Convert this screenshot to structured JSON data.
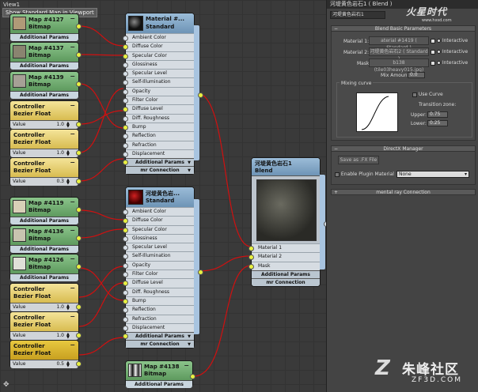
{
  "viewport": {
    "title": "View1",
    "tooltip": "Show Standard Map in Viewport",
    "map_nodes": [
      {
        "name": "Map #4127",
        "type": "Bitmap",
        "footer": "Additional Params",
        "texture": "#b09a78"
      },
      {
        "name": "Map #4137",
        "type": "Bitmap",
        "footer": "Additional Params",
        "texture": "#8a8470"
      },
      {
        "name": "Map #4139",
        "type": "Bitmap",
        "footer": "Additional Params",
        "texture": "#a6a096"
      },
      {
        "name": "Map #4119",
        "type": "Bitmap",
        "footer": "Additional Params",
        "texture": "#d8d0b8"
      },
      {
        "name": "Map #4136",
        "type": "Bitmap",
        "footer": "Additional Params",
        "texture": "#c8c4b0"
      },
      {
        "name": "Map #4126",
        "type": "Bitmap",
        "footer": "Additional Params",
        "texture": "#e0e0d8"
      }
    ],
    "ctrl_nodes": [
      {
        "name": "Controller",
        "type": "Bezier Float",
        "label": "Value",
        "value": "1.0"
      },
      {
        "name": "Controller",
        "type": "Bezier Float",
        "label": "Value",
        "value": "1.0"
      },
      {
        "name": "Controller",
        "type": "Bezier Float",
        "label": "Value",
        "value": "0.3"
      },
      {
        "name": "Controller",
        "type": "Bezier Float",
        "label": "Value",
        "value": "1.0"
      },
      {
        "name": "Controller",
        "type": "Bezier Float",
        "label": "Value",
        "value": "1.0"
      },
      {
        "name": "Controller",
        "type": "Bezier Float",
        "label": "Value",
        "value": "0.5"
      }
    ],
    "materials": [
      {
        "name": "Material #...",
        "type": "Standard",
        "footer1": "Additional Params",
        "footer2": "mr Connection"
      },
      {
        "name": "河堤黄色岩...",
        "type": "Standard",
        "footer1": "Additional Params",
        "footer2": "mr Connection"
      }
    ],
    "slots": [
      "Ambient Color",
      "Diffuse Color",
      "Specular Color",
      "Glossiness",
      "Specular Level",
      "Self-Illumination",
      "Opacity",
      "Filter Color",
      "Diffuse Level",
      "Diff. Roughness",
      "Bump",
      "Reflection",
      "Refraction",
      "Displacement"
    ],
    "bitmap_node": {
      "name": "Map #4138",
      "type": "Bitmap",
      "footer": "Additional Params"
    },
    "blend_node": {
      "name": "河堤黄色岩石1",
      "type": "Blend",
      "slots": [
        "Material 1",
        "Material 2",
        "Mask"
      ],
      "footer1": "Additional Params",
      "footer2": "mr Connection"
    }
  },
  "panel": {
    "title": "河堤黄色岩石1 ( Blend )",
    "name_field": "河堤黄色岩石1",
    "logo_text": "火星时代",
    "logo_url": "www.hxsd.com",
    "blend_params": {
      "header": "Blend Basic Parameters",
      "material1_label": "Material 1:",
      "material1_value": "aterial #1419  ( Standard )",
      "material2_label": "Material 2:",
      "material2_value": "河堤黄色岩石2  ( Standard )",
      "mask_label": "Mask:",
      "mask_value": "b138 (tile03heavy015.jpg)",
      "interactive": "Interactive",
      "mix_amount_label": "Mix Amount:",
      "mix_amount_value": "0.0",
      "mixing_curve_label": "Mixing curve",
      "use_curve_label": "Use Curve",
      "transition_zone_label": "Transition zone:",
      "upper_label": "Upper:",
      "upper_value": "0.75",
      "lower_label": "Lower:",
      "lower_value": "0.25"
    },
    "directx": {
      "header": "DirectX Manager",
      "save_button": "Save as .FX File",
      "enable_plugin_label": "Enable Plugin Material",
      "plugin_select": "None"
    },
    "mr_connection": {
      "header": "mental ray Connection"
    }
  },
  "watermark": {
    "cn": "朱峰社区",
    "en": "ZF3D.COM"
  }
}
